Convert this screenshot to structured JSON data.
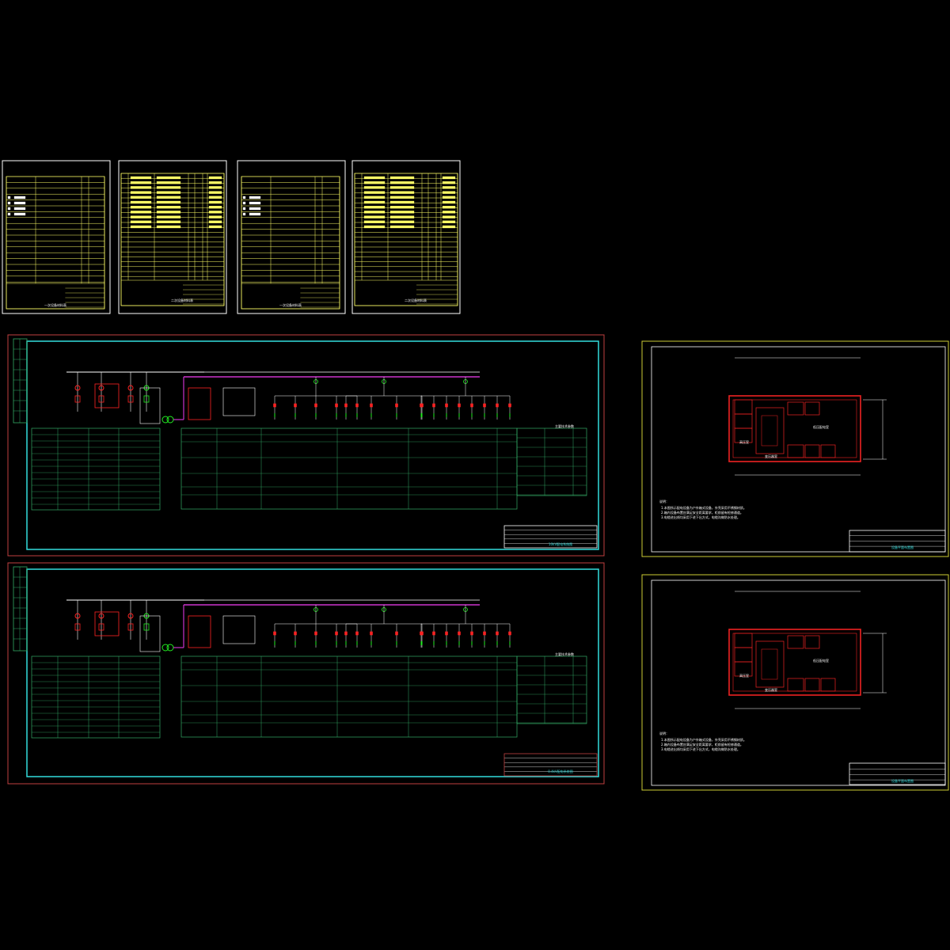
{
  "colors": {
    "background": "#000000",
    "sheet_border": "#ffffff",
    "table_line": "#ffff66",
    "frame_red": "#c04040",
    "frame_cyan": "#33dddd",
    "table_green": "#33aa66",
    "busbar": "#cc33cc",
    "device_red": "#ff2222",
    "device_green": "#22ee22",
    "room_red": "#ee2222",
    "frame_yellow": "#cccc33"
  },
  "sheets": {
    "material_list_a": {
      "title": "一次设备材料表"
    },
    "material_list_b": {
      "title": "二次设备材料表"
    },
    "material_list_c": {
      "title": "一次设备材料表"
    },
    "material_list_d": {
      "title": "二次设备材料表"
    }
  },
  "schematic_top": {
    "legend_title": "主要技术参数",
    "title_block": "10kV配电系统图"
  },
  "schematic_bottom": {
    "legend_title": "主要技术参数",
    "title_block": "0.4kV配电系统图"
  },
  "layout_top": {
    "room_main": "低压配电室",
    "room_side": "高压室",
    "room_bottom": "变压器室",
    "note_heading": "说明：",
    "notes": [
      "1.本图所示配电设备为户外箱式设备，外壳采用不锈钢材质。",
      "2.箱内设备布置应满足安全距离要求，柜前留有检修通道。",
      "3.电缆进出线均采用下进下出方式，电缆沟做防水处理。"
    ],
    "title_block": "设备平面布置图"
  },
  "layout_bottom": {
    "room_main": "低压配电室",
    "room_side": "高压室",
    "room_bottom": "变压器室",
    "note_heading": "说明：",
    "notes": [
      "1.本图所示配电设备为户外箱式设备，外壳采用不锈钢材质。",
      "2.箱内设备布置应满足安全距离要求，柜前留有检修通道。",
      "3.电缆进出线均采用下进下出方式，电缆沟做防水处理。"
    ],
    "title_block": "设备平面布置图"
  }
}
